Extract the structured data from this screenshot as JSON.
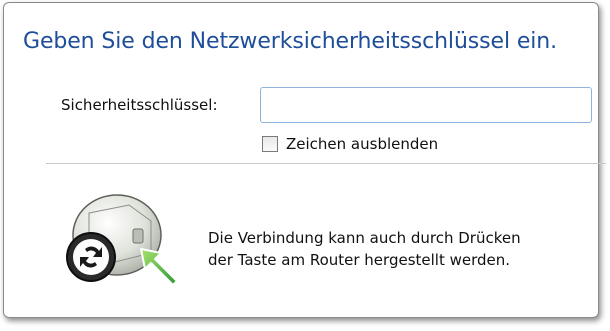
{
  "dialog": {
    "heading": "Geben Sie den Netzwerksicherheitsschlüssel ein.",
    "security_key": {
      "label": "Sicherheitsschlüssel:",
      "value": "",
      "placeholder": ""
    },
    "hide_characters": {
      "label": "Zeichen ausblenden",
      "checked": false
    },
    "wps_info": {
      "line1": "Die Verbindung kann auch durch Drücken",
      "line2": "der Taste am Router hergestellt werden."
    }
  },
  "colors": {
    "heading": "#1e4e9a",
    "input_border": "#8fb4dc",
    "arrow": "#3cb04a",
    "router_body": "#d8dcd2"
  },
  "icons": {
    "router": "router-icon",
    "wps_button": "wps-button-icon",
    "arrow": "green-arrow-icon"
  }
}
